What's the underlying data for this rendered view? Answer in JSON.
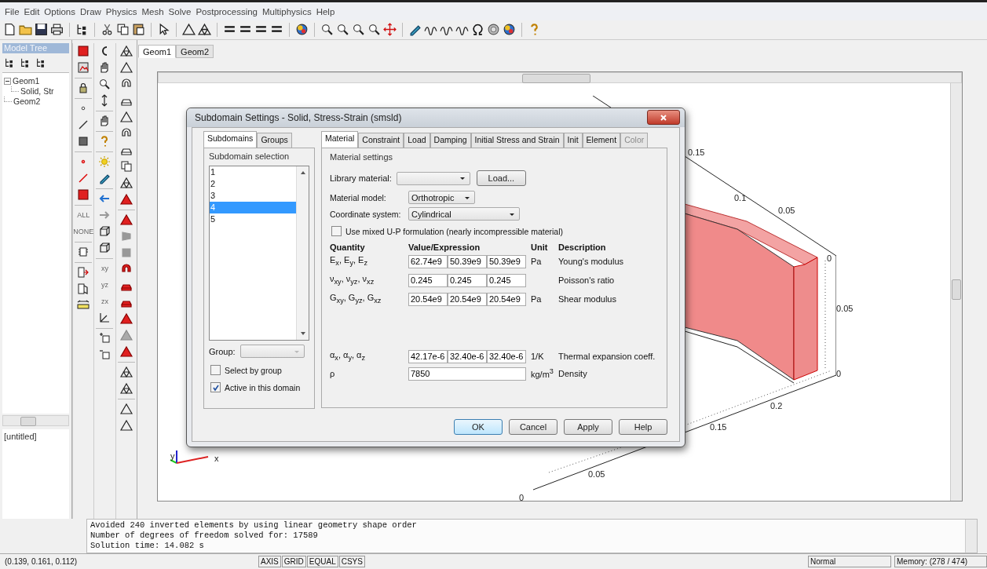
{
  "menu": [
    "File",
    "Edit",
    "Options",
    "Draw",
    "Physics",
    "Mesh",
    "Solve",
    "Postprocessing",
    "Multiphysics",
    "Help"
  ],
  "model_tree": {
    "title": "Model Tree",
    "nodes": [
      {
        "label": "Geom1",
        "expanded": true,
        "children": [
          {
            "label": "Solid, Str"
          }
        ]
      },
      {
        "label": "Geom2"
      }
    ],
    "file": "[untitled]"
  },
  "icon_texts": [
    "ALL",
    "NONE",
    "xy",
    "yz",
    "zx"
  ],
  "canvas_tabs": [
    {
      "label": "Geom1",
      "selected": true
    },
    {
      "label": "Geom2",
      "selected": false
    }
  ],
  "axes": {
    "tick_labels": [
      "0.15",
      "0.1",
      "0.05",
      "0",
      "0.05",
      "0",
      "0.2",
      "0.15",
      "0.05",
      "0"
    ],
    "triad": [
      "y",
      "x"
    ]
  },
  "dialog": {
    "title": "Subdomain Settings - Solid, Stress-Strain (smsld)",
    "left_tabs": [
      {
        "label": "Subdomains",
        "selected": true
      },
      {
        "label": "Groups",
        "selected": false
      }
    ],
    "selection": {
      "title": "Subdomain selection",
      "items": [
        {
          "label": "1",
          "selected": false
        },
        {
          "label": "2",
          "selected": false
        },
        {
          "label": "3",
          "selected": false
        },
        {
          "label": "4",
          "selected": true
        },
        {
          "label": "5",
          "selected": false
        }
      ]
    },
    "group": {
      "label": "Group:"
    },
    "options": [
      {
        "label": "Select by group",
        "checked": false
      },
      {
        "label": "Active in this domain",
        "checked": true
      }
    ],
    "tabs": [
      {
        "label": "Material",
        "selected": true,
        "disabled": false
      },
      {
        "label": "Constraint",
        "selected": false,
        "disabled": false
      },
      {
        "label": "Load",
        "selected": false,
        "disabled": false
      },
      {
        "label": "Damping",
        "selected": false,
        "disabled": false
      },
      {
        "label": "Initial Stress and Strain",
        "selected": false,
        "disabled": false
      },
      {
        "label": "Init",
        "selected": false,
        "disabled": false
      },
      {
        "label": "Element",
        "selected": false,
        "disabled": false
      },
      {
        "label": "Color",
        "selected": false,
        "disabled": true
      }
    ],
    "material": {
      "title": "Material settings",
      "library_label": "Library material:",
      "load_button": "Load...",
      "model_label": "Material model:",
      "model_value": "Orthotropic",
      "coord_label": "Coordinate system:",
      "coord_value": "Cylindrical",
      "mixed": {
        "label": "Use mixed U-P formulation (nearly incompressible material)",
        "checked": false
      },
      "headers": [
        "Quantity",
        "Value/Expression",
        "Unit",
        "Description"
      ],
      "rows": [
        {
          "quantity": "E$_{x}$, E$_{y}$, E$_{z}$",
          "values": [
            "62.74e9",
            "50.39e9",
            "50.39e9"
          ],
          "unit": "Pa",
          "description": "Young's modulus"
        },
        {
          "quantity": "ν$_{xy}$, ν$_{yz}$, ν$_{xz}$",
          "values": [
            "0.245",
            "0.245",
            "0.245"
          ],
          "description": "Poisson's ratio"
        },
        {
          "quantity": "G$_{xy}$, G$_{yz}$, G$_{xz}$",
          "values": [
            "20.54e9",
            "20.54e9",
            "20.54e9"
          ],
          "unit": "Pa",
          "description": "Shear modulus"
        }
      ],
      "thermal_rows": [
        {
          "quantity": "α$_{x}$, α$_{y}$, α$_{z}$",
          "values": [
            "42.17e-6",
            "32.40e-6",
            "32.40e-6"
          ],
          "unit": "1/K",
          "description": "Thermal expansion coeff."
        },
        {
          "quantity": "ρ",
          "values": [
            "7850"
          ],
          "unit": "kg/m$^{3}$",
          "description": "Density"
        }
      ]
    },
    "buttons": [
      {
        "label": "OK",
        "default": true
      },
      {
        "label": "Cancel",
        "default": false
      },
      {
        "label": "Apply",
        "default": false
      },
      {
        "label": "Help",
        "default": false
      }
    ]
  },
  "log": [
    "Avoided 240 inverted elements by using linear geometry shape order",
    "Number of degrees of freedom solved for: 17589",
    "Solution time: 14.082 s"
  ],
  "status_bar": {
    "coordinates": "(0.139, 0.161, 0.112)",
    "toggles": [
      "AXIS",
      "GRID",
      "EQUAL",
      "CSYS"
    ],
    "mode": "Normal",
    "memory": "Memory: (278 / 474)"
  }
}
